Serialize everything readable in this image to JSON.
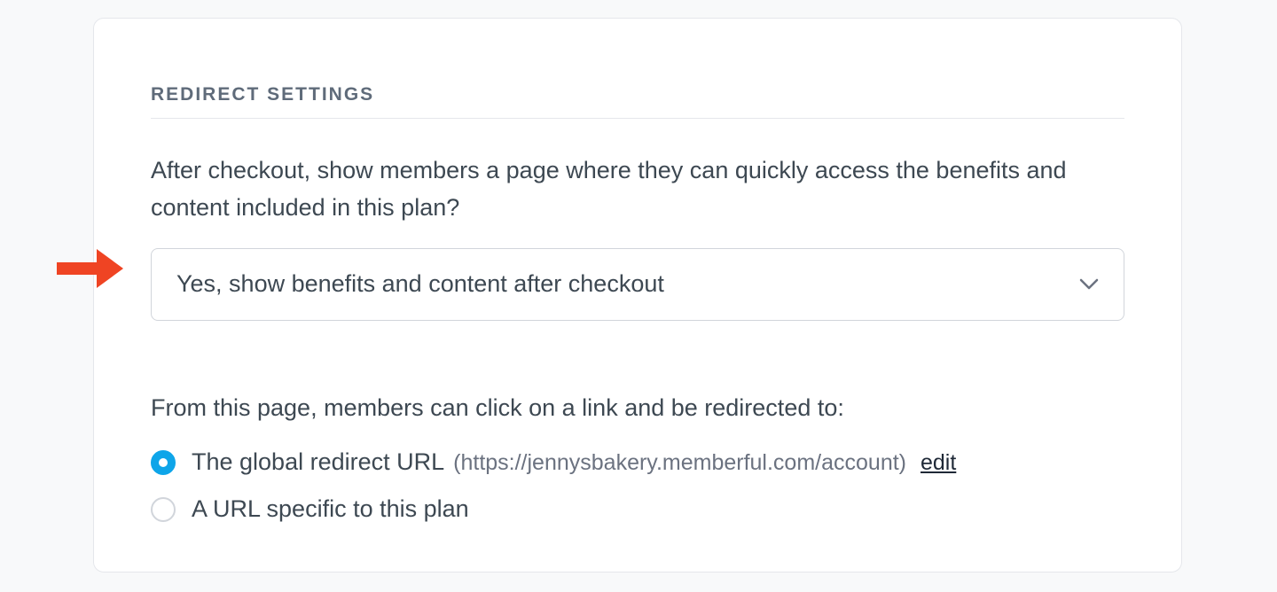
{
  "section": {
    "title": "REDIRECT SETTINGS",
    "description": "After checkout, show members a page where they can quickly access the benefits and content included in this plan?",
    "select": {
      "selected_label": "Yes, show benefits and content after checkout"
    },
    "sub_description": "From this page, members can click on a link and be redirected to:",
    "radio": {
      "options": [
        {
          "label": "The global redirect URL",
          "url_hint": "(https://jennysbakery.memberful.com/account)",
          "edit_label": "edit",
          "selected": true
        },
        {
          "label": "A URL specific to this plan",
          "selected": false
        }
      ]
    }
  }
}
